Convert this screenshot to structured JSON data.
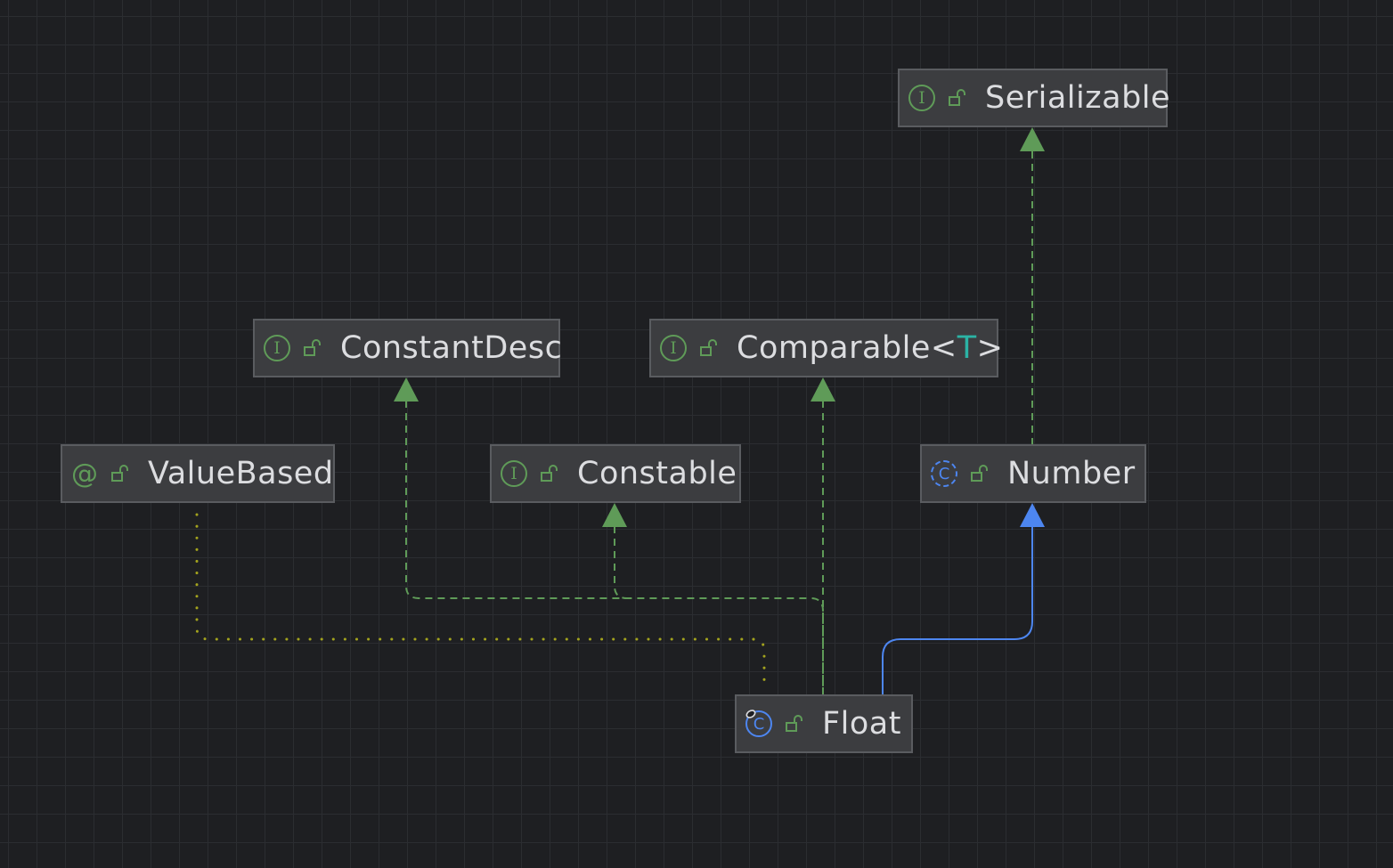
{
  "diagram": {
    "nodes": {
      "serializable": {
        "label": "Serializable",
        "kind": "interface",
        "kind_glyph": "I",
        "access": "public-lock-icon"
      },
      "constant_desc": {
        "label": "ConstantDesc",
        "kind": "interface",
        "kind_glyph": "I",
        "access": "public-lock-icon"
      },
      "comparable": {
        "label": "Comparable<",
        "type_param": "T",
        "label_suffix": ">",
        "kind": "interface",
        "kind_glyph": "I",
        "access": "public-lock-icon"
      },
      "value_based": {
        "label": "ValueBased",
        "kind": "annotation",
        "kind_glyph": "@",
        "access": "public-lock-icon"
      },
      "constable": {
        "label": "Constable",
        "kind": "interface",
        "kind_glyph": "I",
        "access": "public-lock-icon"
      },
      "number": {
        "label": "Number",
        "kind": "abstract-class",
        "kind_glyph": "C",
        "access": "public-lock-icon"
      },
      "float": {
        "label": "Float",
        "kind": "final-class",
        "kind_glyph": "C",
        "access": "public-lock-icon"
      }
    },
    "edges": [
      {
        "from": "Number",
        "to": "Serializable",
        "type": "implements"
      },
      {
        "from": "Float",
        "to": "ConstantDesc",
        "type": "implements"
      },
      {
        "from": "Float",
        "to": "Constable",
        "type": "implements"
      },
      {
        "from": "Float",
        "to": "Comparable<T>",
        "type": "implements"
      },
      {
        "from": "Float",
        "to": "Number",
        "type": "extends"
      },
      {
        "from": "Float",
        "to": "ValueBased",
        "type": "annotated-by"
      }
    ],
    "colors": {
      "background": "#1e1f22",
      "node_fill": "#3c3d40",
      "node_border": "#5a5c60",
      "text": "#dcdde0",
      "implements_edge": "#5f9b58",
      "extends_edge": "#4d86f0",
      "annotation_edge": "#a3a31d",
      "type_param": "#2bb3a5"
    }
  }
}
